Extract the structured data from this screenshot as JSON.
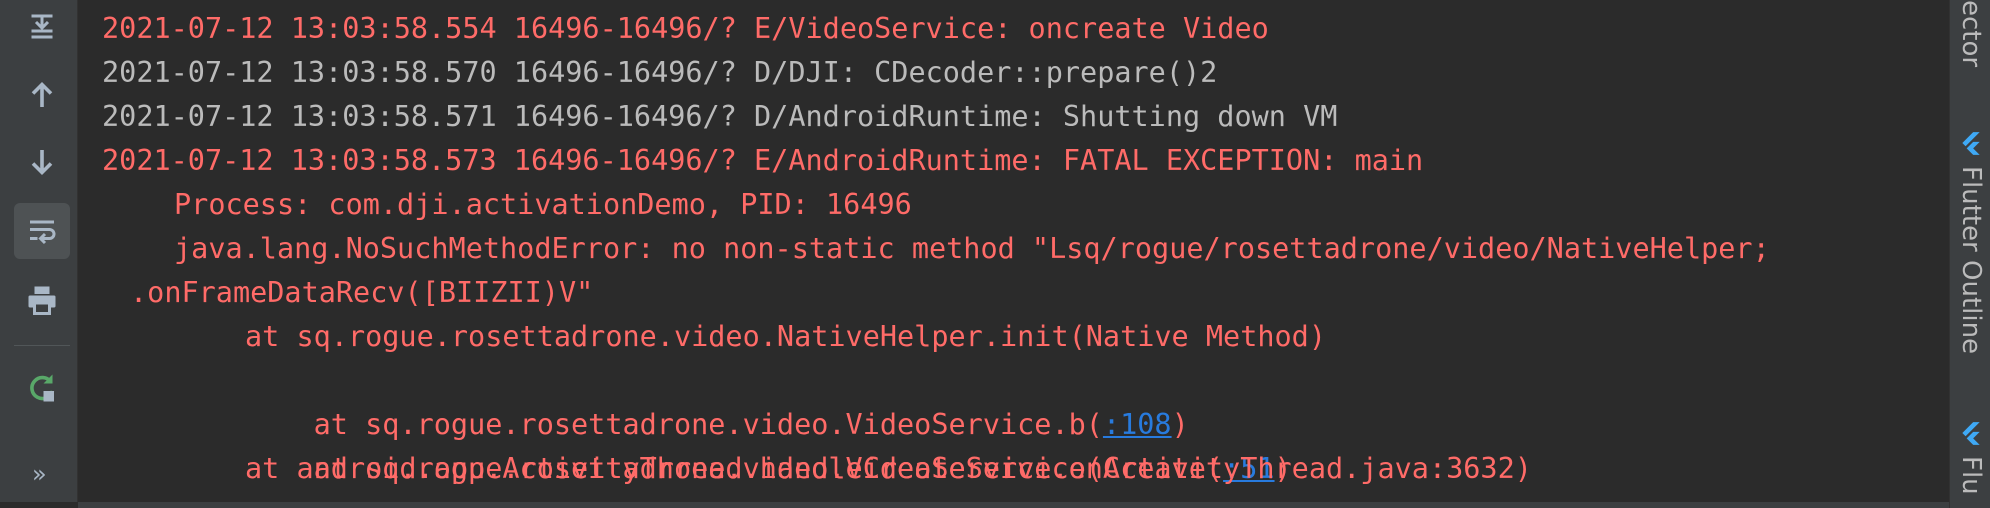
{
  "toolbar": {
    "icons": [
      "scroll-to-end-icon",
      "up-arrow-icon",
      "down-arrow-icon",
      "soft-wrap-icon",
      "print-icon",
      "restart-icon"
    ],
    "more_label": "»"
  },
  "log": [
    {
      "level": "E",
      "text": "2021-07-12 13:03:58.554 16496-16496/? E/VideoService: oncreate Video"
    },
    {
      "level": "D",
      "text": "2021-07-12 13:03:58.570 16496-16496/? D/DJI: CDecoder::prepare()2"
    },
    {
      "level": "D",
      "text": "2021-07-12 13:03:58.571 16496-16496/? D/AndroidRuntime: Shutting down VM"
    },
    {
      "level": "E",
      "text": "2021-07-12 13:03:58.573 16496-16496/? E/AndroidRuntime: FATAL EXCEPTION: main"
    },
    {
      "level": "E",
      "text": "Process: com.dji.activationDemo, PID: 16496"
    },
    {
      "level": "E",
      "text": "java.lang.NoSuchMethodError: no non-static method \"Lsq/rogue/rosettadrone/video/NativeHelper;"
    },
    {
      "level": "E",
      "text": ".onFrameDataRecv([BIIZII)V\""
    },
    {
      "level": "E",
      "text": "at sq.rogue.rosettadrone.video.NativeHelper.init(Native Method)"
    },
    {
      "level": "E",
      "pre": "at sq.rogue.rosettadrone.video.VideoService.b(",
      "link": ":108",
      "post": ")"
    },
    {
      "level": "E",
      "pre": "at sq.rogue.rosettadrone.video.VideoService.onCreate(",
      "link": ":51",
      "post": ")"
    },
    {
      "level": "E",
      "text": "at android.app.ActivityThread.handleCreateService(ActivityThread.java:3632)"
    }
  ],
  "right_panel": {
    "tab1_label": "ector",
    "tab2_label": "Flutter Outline",
    "tab3_label": "Flu",
    "flutter_color": "#3fa9f5"
  },
  "colors": {
    "error": "#ff6b68",
    "debug": "#bbbbbb",
    "link": "#287bde",
    "background": "#2b2b2b"
  }
}
